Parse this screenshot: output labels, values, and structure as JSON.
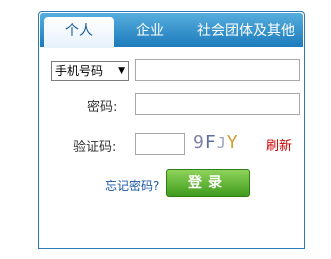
{
  "tabs": [
    {
      "label": "个人",
      "active": true
    },
    {
      "label": "企业",
      "active": false
    },
    {
      "label": "社会团体及其他",
      "active": false
    }
  ],
  "form": {
    "account_type_selected": "手机号码",
    "account_value": "",
    "password_label": "密码:",
    "password_value": "",
    "captcha_label": "验证码:",
    "captcha_value": "",
    "captcha_text": "9FJY",
    "refresh_label": "刷新",
    "forgot_password_label": "忘记密码?",
    "login_label": "登录"
  },
  "colors": {
    "tab_bar": "#1c7bbb",
    "login_button": "#4fa825",
    "refresh": "#cc0000",
    "link": "#1a56a8"
  }
}
